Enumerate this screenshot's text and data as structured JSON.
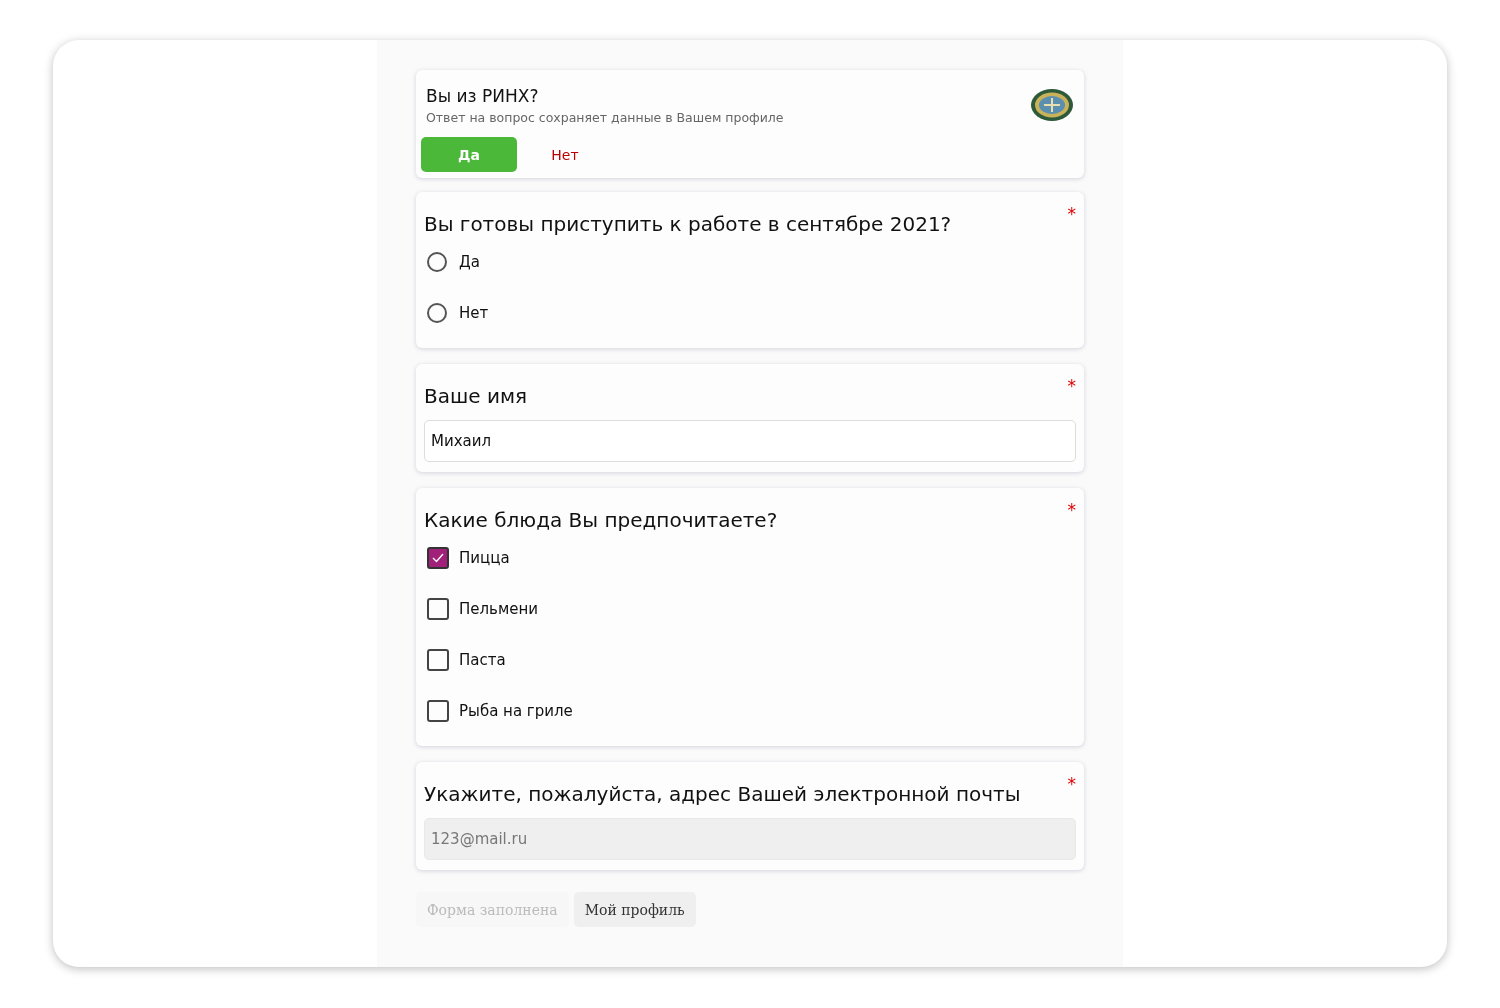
{
  "profile_card": {
    "title": "Вы из РИНХ?",
    "subtitle": "Ответ на вопрос сохраняет данные в Вашем профиле",
    "options": [
      {
        "label": "Да",
        "selected": true
      },
      {
        "label": "Нет",
        "selected": false
      }
    ]
  },
  "questions": [
    {
      "kind": "radio",
      "title": "Вы готовы приступить к работе в сентябре 2021?",
      "required_mark": "*",
      "options": [
        {
          "label": "Да",
          "selected": false
        },
        {
          "label": "Нет",
          "selected": false
        }
      ]
    },
    {
      "kind": "text",
      "title": "Ваше имя",
      "required_mark": "*",
      "value": "Михаил",
      "disabled": false
    },
    {
      "kind": "checkbox",
      "title": "Какие блюда Вы предпочитаете?",
      "required_mark": "*",
      "options": [
        {
          "label": "Пицца",
          "checked": true
        },
        {
          "label": "Пельмени",
          "checked": false
        },
        {
          "label": "Паста",
          "checked": false
        },
        {
          "label": "Рыба на гриле",
          "checked": false
        }
      ]
    },
    {
      "kind": "text",
      "title": "Укажите, пожалуйста, адрес Вашей электронной почты",
      "required_mark": "*",
      "value": "123@mail.ru",
      "disabled": true
    }
  ],
  "buttons": [
    {
      "label": "Форма заполнена",
      "disabled": true
    },
    {
      "label": "Мой профиль",
      "disabled": false
    }
  ]
}
